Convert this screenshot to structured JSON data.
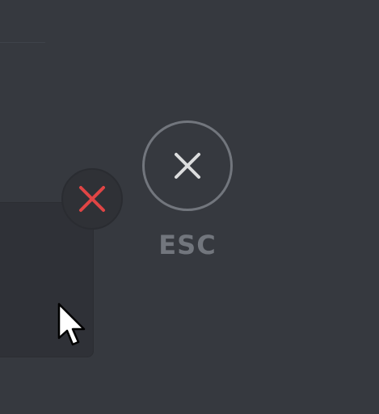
{
  "close_button": {
    "label": "ESC",
    "icon": "x-icon"
  },
  "panel_close_icon": "x-icon",
  "colors": {
    "background": "#36393f",
    "panel": "#2f3137",
    "muted": "#72767d",
    "danger": "#e04545",
    "icon_light": "#dcddde"
  }
}
